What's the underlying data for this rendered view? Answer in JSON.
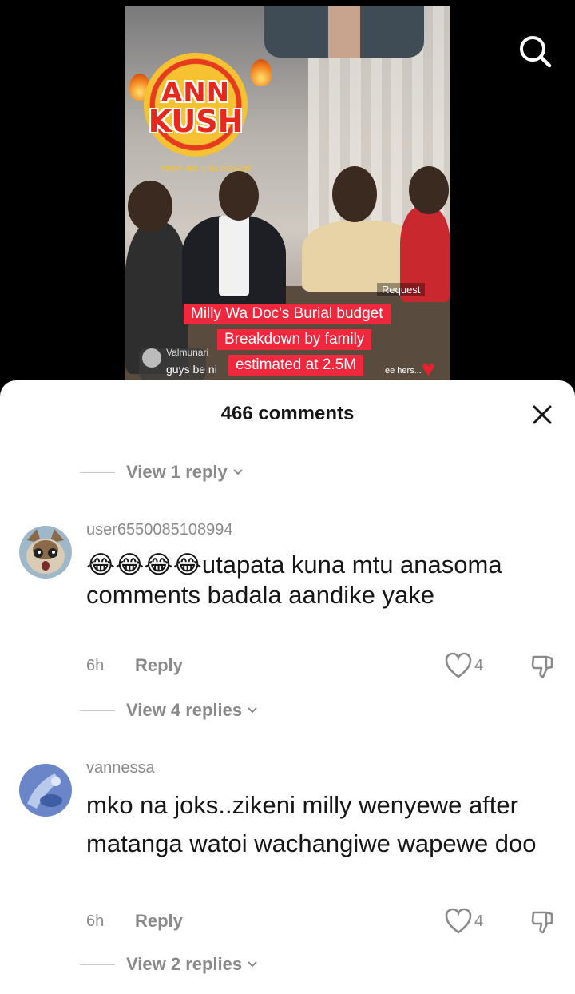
{
  "video": {
    "logo_line1": "ANN",
    "logo_line2": "KUSH",
    "logo_tagline": "YOUR NO 1 BLOGGER",
    "request_tag": "Request",
    "caption_lines": [
      "Milly Wa Doc's Burial budget",
      "Breakdown by family",
      "estimated at 2.5M"
    ],
    "live_comment": {
      "user": "Valmunari",
      "text": "guys be ni",
      "side_text": "ee hers..."
    }
  },
  "sheet": {
    "title": "466 comments"
  },
  "comments": [
    {
      "view_replies_above": "View 1 reply",
      "username": "user6550085108994",
      "emojis": "😂😂😂😂",
      "text": "utapata kuna mtu anasoma comments badala aandike yake",
      "time": "6h",
      "reply_label": "Reply",
      "likes": "4",
      "view_replies": "View 4 replies"
    },
    {
      "username": "vannessa",
      "text": "mko na joks..zikeni milly wenyewe after matanga watoi wachangiwe wapewe doo",
      "time": "6h",
      "reply_label": "Reply",
      "likes": "4",
      "view_replies": "View 2 replies"
    }
  ],
  "colors": {
    "caption_red": "#f0283e",
    "sheet_bg": "#ffffff",
    "muted": "#8a8a8a"
  }
}
